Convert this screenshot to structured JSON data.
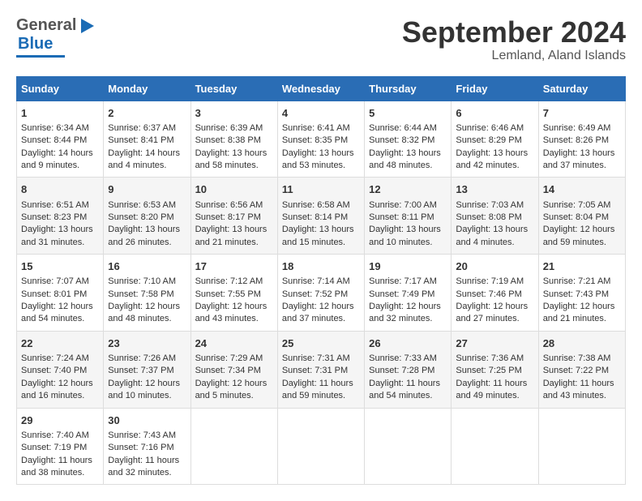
{
  "header": {
    "logo_general": "General",
    "logo_blue": "Blue",
    "month_title": "September 2024",
    "location": "Lemland, Aland Islands"
  },
  "days_of_week": [
    "Sunday",
    "Monday",
    "Tuesday",
    "Wednesday",
    "Thursday",
    "Friday",
    "Saturday"
  ],
  "weeks": [
    [
      {
        "day": "1",
        "sunrise": "Sunrise: 6:34 AM",
        "sunset": "Sunset: 8:44 PM",
        "daylight": "Daylight: 14 hours and 9 minutes."
      },
      {
        "day": "2",
        "sunrise": "Sunrise: 6:37 AM",
        "sunset": "Sunset: 8:41 PM",
        "daylight": "Daylight: 14 hours and 4 minutes."
      },
      {
        "day": "3",
        "sunrise": "Sunrise: 6:39 AM",
        "sunset": "Sunset: 8:38 PM",
        "daylight": "Daylight: 13 hours and 58 minutes."
      },
      {
        "day": "4",
        "sunrise": "Sunrise: 6:41 AM",
        "sunset": "Sunset: 8:35 PM",
        "daylight": "Daylight: 13 hours and 53 minutes."
      },
      {
        "day": "5",
        "sunrise": "Sunrise: 6:44 AM",
        "sunset": "Sunset: 8:32 PM",
        "daylight": "Daylight: 13 hours and 48 minutes."
      },
      {
        "day": "6",
        "sunrise": "Sunrise: 6:46 AM",
        "sunset": "Sunset: 8:29 PM",
        "daylight": "Daylight: 13 hours and 42 minutes."
      },
      {
        "day": "7",
        "sunrise": "Sunrise: 6:49 AM",
        "sunset": "Sunset: 8:26 PM",
        "daylight": "Daylight: 13 hours and 37 minutes."
      }
    ],
    [
      {
        "day": "8",
        "sunrise": "Sunrise: 6:51 AM",
        "sunset": "Sunset: 8:23 PM",
        "daylight": "Daylight: 13 hours and 31 minutes."
      },
      {
        "day": "9",
        "sunrise": "Sunrise: 6:53 AM",
        "sunset": "Sunset: 8:20 PM",
        "daylight": "Daylight: 13 hours and 26 minutes."
      },
      {
        "day": "10",
        "sunrise": "Sunrise: 6:56 AM",
        "sunset": "Sunset: 8:17 PM",
        "daylight": "Daylight: 13 hours and 21 minutes."
      },
      {
        "day": "11",
        "sunrise": "Sunrise: 6:58 AM",
        "sunset": "Sunset: 8:14 PM",
        "daylight": "Daylight: 13 hours and 15 minutes."
      },
      {
        "day": "12",
        "sunrise": "Sunrise: 7:00 AM",
        "sunset": "Sunset: 8:11 PM",
        "daylight": "Daylight: 13 hours and 10 minutes."
      },
      {
        "day": "13",
        "sunrise": "Sunrise: 7:03 AM",
        "sunset": "Sunset: 8:08 PM",
        "daylight": "Daylight: 13 hours and 4 minutes."
      },
      {
        "day": "14",
        "sunrise": "Sunrise: 7:05 AM",
        "sunset": "Sunset: 8:04 PM",
        "daylight": "Daylight: 12 hours and 59 minutes."
      }
    ],
    [
      {
        "day": "15",
        "sunrise": "Sunrise: 7:07 AM",
        "sunset": "Sunset: 8:01 PM",
        "daylight": "Daylight: 12 hours and 54 minutes."
      },
      {
        "day": "16",
        "sunrise": "Sunrise: 7:10 AM",
        "sunset": "Sunset: 7:58 PM",
        "daylight": "Daylight: 12 hours and 48 minutes."
      },
      {
        "day": "17",
        "sunrise": "Sunrise: 7:12 AM",
        "sunset": "Sunset: 7:55 PM",
        "daylight": "Daylight: 12 hours and 43 minutes."
      },
      {
        "day": "18",
        "sunrise": "Sunrise: 7:14 AM",
        "sunset": "Sunset: 7:52 PM",
        "daylight": "Daylight: 12 hours and 37 minutes."
      },
      {
        "day": "19",
        "sunrise": "Sunrise: 7:17 AM",
        "sunset": "Sunset: 7:49 PM",
        "daylight": "Daylight: 12 hours and 32 minutes."
      },
      {
        "day": "20",
        "sunrise": "Sunrise: 7:19 AM",
        "sunset": "Sunset: 7:46 PM",
        "daylight": "Daylight: 12 hours and 27 minutes."
      },
      {
        "day": "21",
        "sunrise": "Sunrise: 7:21 AM",
        "sunset": "Sunset: 7:43 PM",
        "daylight": "Daylight: 12 hours and 21 minutes."
      }
    ],
    [
      {
        "day": "22",
        "sunrise": "Sunrise: 7:24 AM",
        "sunset": "Sunset: 7:40 PM",
        "daylight": "Daylight: 12 hours and 16 minutes."
      },
      {
        "day": "23",
        "sunrise": "Sunrise: 7:26 AM",
        "sunset": "Sunset: 7:37 PM",
        "daylight": "Daylight: 12 hours and 10 minutes."
      },
      {
        "day": "24",
        "sunrise": "Sunrise: 7:29 AM",
        "sunset": "Sunset: 7:34 PM",
        "daylight": "Daylight: 12 hours and 5 minutes."
      },
      {
        "day": "25",
        "sunrise": "Sunrise: 7:31 AM",
        "sunset": "Sunset: 7:31 PM",
        "daylight": "Daylight: 11 hours and 59 minutes."
      },
      {
        "day": "26",
        "sunrise": "Sunrise: 7:33 AM",
        "sunset": "Sunset: 7:28 PM",
        "daylight": "Daylight: 11 hours and 54 minutes."
      },
      {
        "day": "27",
        "sunrise": "Sunrise: 7:36 AM",
        "sunset": "Sunset: 7:25 PM",
        "daylight": "Daylight: 11 hours and 49 minutes."
      },
      {
        "day": "28",
        "sunrise": "Sunrise: 7:38 AM",
        "sunset": "Sunset: 7:22 PM",
        "daylight": "Daylight: 11 hours and 43 minutes."
      }
    ],
    [
      {
        "day": "29",
        "sunrise": "Sunrise: 7:40 AM",
        "sunset": "Sunset: 7:19 PM",
        "daylight": "Daylight: 11 hours and 38 minutes."
      },
      {
        "day": "30",
        "sunrise": "Sunrise: 7:43 AM",
        "sunset": "Sunset: 7:16 PM",
        "daylight": "Daylight: 11 hours and 32 minutes."
      },
      {
        "day": "",
        "sunrise": "",
        "sunset": "",
        "daylight": ""
      },
      {
        "day": "",
        "sunrise": "",
        "sunset": "",
        "daylight": ""
      },
      {
        "day": "",
        "sunrise": "",
        "sunset": "",
        "daylight": ""
      },
      {
        "day": "",
        "sunrise": "",
        "sunset": "",
        "daylight": ""
      },
      {
        "day": "",
        "sunrise": "",
        "sunset": "",
        "daylight": ""
      }
    ]
  ]
}
